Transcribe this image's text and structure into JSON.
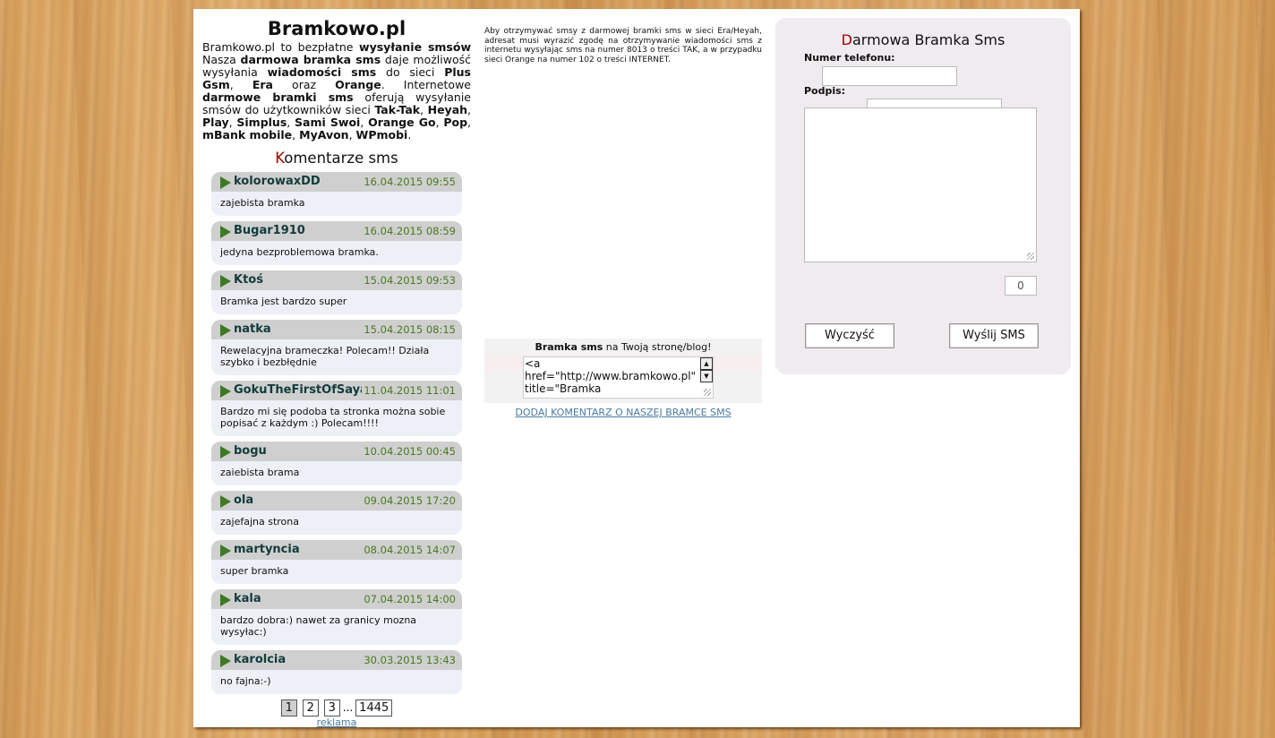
{
  "site": {
    "title": "Bramkowo.pl",
    "intro_parts": [
      {
        "t": "Bramkowo.pl to bezpłatne ",
        "b": false
      },
      {
        "t": "wysyłanie smsów",
        "b": true
      },
      {
        "t": " Nasza ",
        "b": false
      },
      {
        "t": "darmowa bramka sms",
        "b": true
      },
      {
        "t": " daje możliwość wysyłania ",
        "b": false
      },
      {
        "t": "wiadomości sms",
        "b": true
      },
      {
        "t": " do sieci ",
        "b": false
      },
      {
        "t": "Plus Gsm",
        "b": true
      },
      {
        "t": ", ",
        "b": false
      },
      {
        "t": "Era",
        "b": true
      },
      {
        "t": " oraz ",
        "b": false
      },
      {
        "t": "Orange",
        "b": true
      },
      {
        "t": ". Internetowe ",
        "b": false
      },
      {
        "t": "darmowe bramki sms",
        "b": true
      },
      {
        "t": " oferują wysyłanie smsów do użytkowników sieci ",
        "b": false
      },
      {
        "t": "Tak-Tak",
        "b": true
      },
      {
        "t": ", ",
        "b": false
      },
      {
        "t": "Heyah",
        "b": true
      },
      {
        "t": ", ",
        "b": false
      },
      {
        "t": "Play",
        "b": true
      },
      {
        "t": ", ",
        "b": false
      },
      {
        "t": "Simplus",
        "b": true
      },
      {
        "t": ", ",
        "b": false
      },
      {
        "t": "Sami Swoi",
        "b": true
      },
      {
        "t": ", ",
        "b": false
      },
      {
        "t": "Orange Go",
        "b": true
      },
      {
        "t": ", ",
        "b": false
      },
      {
        "t": "Pop",
        "b": true
      },
      {
        "t": ", ",
        "b": false
      },
      {
        "t": "mBank mobile",
        "b": true
      },
      {
        "t": ", ",
        "b": false
      },
      {
        "t": "MyAvon",
        "b": true
      },
      {
        "t": ", ",
        "b": false
      },
      {
        "t": "WPmobi",
        "b": true
      },
      {
        "t": ".",
        "b": false
      }
    ]
  },
  "comments_section": {
    "title_first": "K",
    "title_rest": "omentarze sms",
    "items": [
      {
        "author": "kolorowaxDD",
        "date": "16.04.2015 09:55",
        "text": "zajebista bramka"
      },
      {
        "author": "Bugar1910",
        "date": "16.04.2015 08:59",
        "text": "jedyna bezproblemowa bramka."
      },
      {
        "author": "Ktoś",
        "date": "15.04.2015 09:53",
        "text": "Bramka jest bardzo super"
      },
      {
        "author": "natka",
        "date": "15.04.2015 08:15",
        "text": "Rewelacyjna brameczka! Polecam!! Działa szybko i bezbłędnie"
      },
      {
        "author": "GokuTheFirstOfSayan",
        "date": "11.04.2015 11:01",
        "text": "Bardzo mi się podoba ta stronka można sobie popisać z każdym :) Polecam!!!!"
      },
      {
        "author": "bogu",
        "date": "10.04.2015 00:45",
        "text": "zaiebista brama"
      },
      {
        "author": "ola",
        "date": "09.04.2015 17:20",
        "text": "zajefajna strona"
      },
      {
        "author": "martyncia",
        "date": "08.04.2015 14:07",
        "text": "super bramka"
      },
      {
        "author": "kala",
        "date": "07.04.2015 14:00",
        "text": "bardzo dobra:) nawet za granicy mozna wysyłac:)"
      },
      {
        "author": "karolcia",
        "date": "30.03.2015 13:43",
        "text": "no fajna:-)"
      }
    ],
    "pager": {
      "pages": [
        "1",
        "2",
        "3"
      ],
      "ellipsis": "...",
      "last": "1445",
      "active": "1"
    },
    "ad_link": "reklama"
  },
  "middle": {
    "info": "Aby otrzymywać smsy z darmowej bramki sms w sieci Era/Heyah, adresat musi wyrazić zgodę na otrzymywanie wiadomości sms z internetu wysyłając sms na numer 8013 o treści TAK, a w przypadku sieci Orange na numer 102 o treści INTERNET.",
    "embed_bold": "Bramka sms",
    "embed_rest": " na Twoją stronę/blog!",
    "embed_code": "<a\nhref=\"http://www.bramkowo.pl\"\ntitle=\"Bramka",
    "add_comment": "DODAJ KOMENTARZ O NASZEJ BRAMCE SMS"
  },
  "form": {
    "title_first": "D",
    "title_rest": "armowa Bramka Sms",
    "phone_label": "Numer telefonu:",
    "phone_value": "",
    "signature_label": "Podpis:",
    "message_value": "",
    "counter": "0",
    "clear_label": "Wyczyść",
    "send_label": "Wyślij SMS"
  },
  "colors": {
    "accent_red": "#a00000",
    "author_color": "#123b3b",
    "date_color": "#4a7a1f",
    "link": "#4a7aa0"
  }
}
